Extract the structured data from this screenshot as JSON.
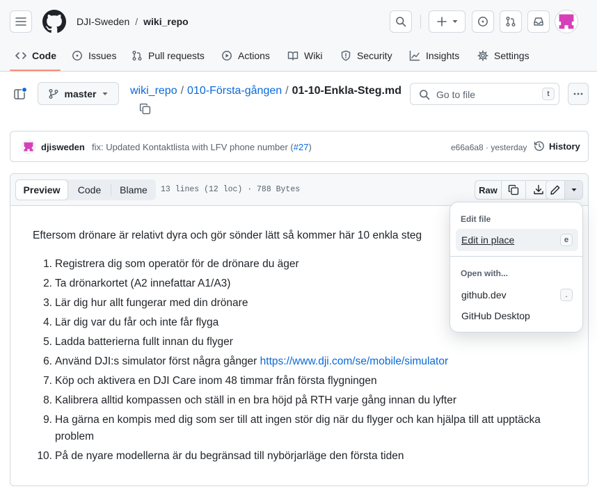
{
  "header": {
    "owner": "DJI-Sweden",
    "separator": "/",
    "repo": "wiki_repo"
  },
  "tabs": [
    {
      "label": "Code",
      "icon": "code-icon",
      "selected": true
    },
    {
      "label": "Issues",
      "icon": "issue-icon"
    },
    {
      "label": "Pull requests",
      "icon": "pull-request-icon"
    },
    {
      "label": "Actions",
      "icon": "play-icon"
    },
    {
      "label": "Wiki",
      "icon": "book-icon"
    },
    {
      "label": "Security",
      "icon": "shield-icon"
    },
    {
      "label": "Insights",
      "icon": "graph-icon"
    },
    {
      "label": "Settings",
      "icon": "gear-icon"
    }
  ],
  "file_nav": {
    "branch": "master",
    "breadcrumb": {
      "repo": "wiki_repo",
      "sep1": "/",
      "folder": "010-Första-gången",
      "sep2": "/",
      "file": "01-10-Enkla-Steg.md"
    },
    "go_to_file_placeholder": "Go to file",
    "go_to_file_shortcut": "t"
  },
  "commit": {
    "author": "djisweden",
    "message_prefix": "fix: Updated Kontaktlista with LFV phone number (",
    "pr_link": "#27",
    "message_suffix": ")",
    "hash_time": "e66a6a8 · yesterday",
    "history_label": "History"
  },
  "file_toolbar": {
    "views": [
      "Preview",
      "Code",
      "Blame"
    ],
    "selected_view": "Preview",
    "file_info": "13 lines (12 loc) · 788 Bytes",
    "raw_label": "Raw"
  },
  "content": {
    "intro": "Eftersom drönare är relativt dyra och gör sönder lätt så kommer här 10 enkla steg",
    "steps": [
      {
        "num": "1.",
        "text": "Registrera dig som operatör för de drönare du äger"
      },
      {
        "num": "2.",
        "text": "Ta drönarkortet (A2 innefattar A1/A3)"
      },
      {
        "num": "3.",
        "text": "Lär dig hur allt fungerar med din drönare"
      },
      {
        "num": "4.",
        "text": "Lär dig var du får och inte får flyga"
      },
      {
        "num": "5.",
        "text": "Ladda batterierna fullt innan du flyger"
      },
      {
        "num": "6.",
        "text": "Använd DJI:s simulator först några gånger ",
        "link": "https://www.dji.com/se/mobile/simulator"
      },
      {
        "num": "7.",
        "text": "Köp och aktivera en DJI Care inom 48 timmar från första flygningen"
      },
      {
        "num": "8.",
        "text": "Kalibrera alltid kompassen och ställ in en bra höjd på RTH varje gång innan du lyfter"
      },
      {
        "num": "9.",
        "text": "Ha gärna en kompis med dig som ser till att ingen stör dig när du flyger och kan hjälpa till att upptäcka problem"
      },
      {
        "num": "10.",
        "text": "På de nyare modellerna är du begränsad till nybörjarläge den första tiden"
      }
    ]
  },
  "edit_menu": {
    "section1": "Edit file",
    "edit_in_place": "Edit in place",
    "edit_in_place_key": "e",
    "section2": "Open with...",
    "github_dev": "github.dev",
    "github_dev_key": ".",
    "github_desktop": "GitHub Desktop"
  },
  "colors": {
    "accent": "#0969da",
    "tab_underline": "#fd8c73",
    "avatar": "#d63fb7"
  }
}
